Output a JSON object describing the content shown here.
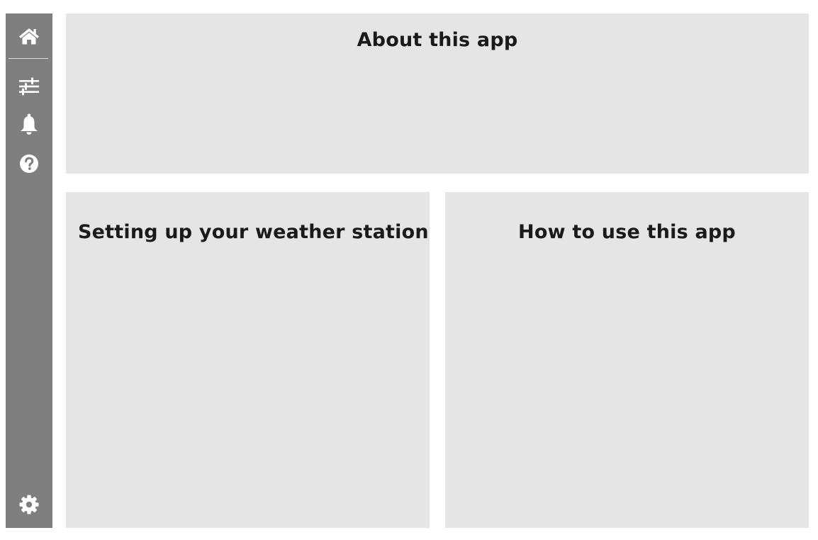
{
  "sidebar": {
    "items": [
      {
        "name": "home",
        "icon": "home-icon"
      },
      {
        "name": "filters",
        "icon": "sliders-icon"
      },
      {
        "name": "notifications",
        "icon": "bell-icon"
      },
      {
        "name": "help",
        "icon": "question-icon"
      }
    ],
    "footer": {
      "name": "settings",
      "icon": "gear-icon"
    },
    "background_color": "#7f7f7f",
    "icon_color": "#ffffff"
  },
  "panels": {
    "about": {
      "title": "About this app"
    },
    "setup": {
      "title": "Setting up your weather station"
    },
    "howto": {
      "title": "How to use this app"
    },
    "background_color": "#e5e5e5"
  }
}
